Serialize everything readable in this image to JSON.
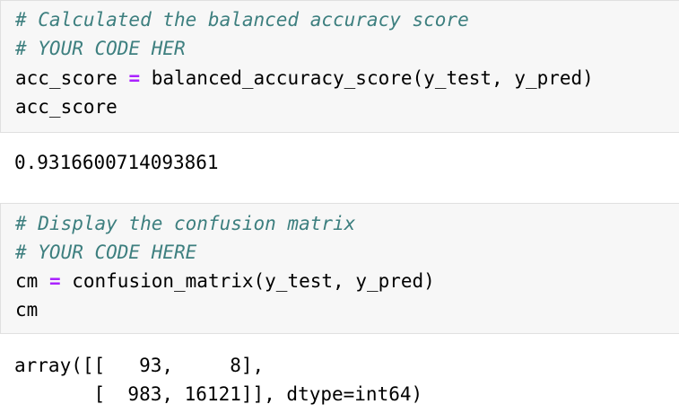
{
  "cells": [
    {
      "input": {
        "comment_1": "# Calculated the balanced accuracy score",
        "comment_2": "# YOUR CODE HER",
        "line_3": {
          "lhs": "acc_score ",
          "operator": "=",
          "rhs": " balanced_accuracy_score(y_test, y_pred)"
        },
        "line_4": "acc_score"
      },
      "output": [
        "0.9316600714093861"
      ]
    },
    {
      "input": {
        "comment_1": "# Display the confusion matrix",
        "comment_2": "# YOUR CODE HERE",
        "line_3": {
          "lhs": "cm ",
          "operator": "=",
          "rhs": " confusion_matrix(y_test, y_pred)"
        },
        "line_4": "cm"
      },
      "output": [
        "array([[   93,     8],",
        "       [  983, 16121]], dtype=int64)"
      ]
    }
  ],
  "colors": {
    "comment": "#3d7f7f",
    "operator": "#aa22ff",
    "input_background": "#f7f7f7"
  }
}
